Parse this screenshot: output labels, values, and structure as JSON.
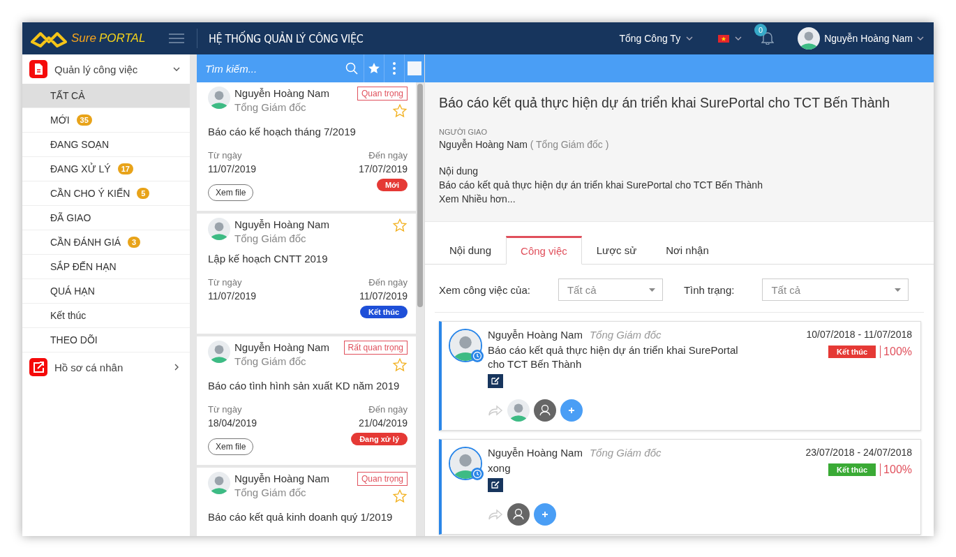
{
  "header": {
    "logo_left": "Sure",
    "logo_right": "PORTAL",
    "title": "HỆ THỐNG QUẢN LÝ CÔNG VIỆC",
    "company": "Tổng Công Ty",
    "notifications": "0",
    "user": "Nguyễn Hoàng Nam"
  },
  "sidebar": {
    "groups": [
      {
        "label": "Quản lý công việc",
        "kind": "document",
        "expanded": true,
        "items": [
          {
            "label": "TẤT CẢ",
            "selected": true
          },
          {
            "label": "MỚI",
            "badge": "35",
            "selected": false
          },
          {
            "label": "ĐANG SOẠN",
            "selected": false
          },
          {
            "label": "ĐANG XỬ LÝ",
            "badge": "17",
            "selected": false
          },
          {
            "label": "CẦN CHO Ý KIẾN",
            "badge": "5",
            "selected": false
          },
          {
            "label": "ĐÃ GIAO",
            "selected": false
          },
          {
            "label": "CẦN ĐÁNH GIÁ",
            "badge": "3",
            "selected": false
          },
          {
            "label": "SẮP ĐẾN HẠN",
            "selected": false
          },
          {
            "label": "QUÁ HẠN",
            "selected": false
          },
          {
            "label": "Kết thúc",
            "selected": false
          },
          {
            "label": "THEO DÕI",
            "selected": false
          }
        ]
      },
      {
        "label": "Hồ sơ cá nhân",
        "kind": "share",
        "expanded": false
      }
    ]
  },
  "task_list": {
    "search": {
      "placeholder": "Tìm kiếm..."
    },
    "cards": [
      {
        "name": "Nguyễn Hoàng Nam",
        "role": "Tổng Giám đốc",
        "priority": "Quan trọng",
        "starred": false,
        "title": "Báo cáo kế hoạch tháng 7/2019",
        "from_label": "Từ ngày",
        "from": "11/07/2019",
        "to_label": "Đến ngày",
        "to": "17/07/2019",
        "file_button": "Xem file",
        "status": {
          "label": "Mới",
          "color": "#e53935"
        }
      },
      {
        "name": "Nguyễn Hoàng Nam",
        "role": "Tổng Giám đốc",
        "starred": false,
        "title": "Lập kế hoạch CNTT 2019",
        "from_label": "Từ ngày",
        "from": "11/07/2019",
        "to_label": "Đến ngày",
        "to": "11/07/2019",
        "status": {
          "label": "Kết thúc",
          "color": "#1e4fd8"
        }
      },
      {
        "name": "Nguyễn Hoàng Nam",
        "role": "Tổng Giám đốc",
        "priority": "Rất quan trọng",
        "starred": false,
        "title": "Báo cáo tình hình sản xuất KD năm 2019",
        "from_label": "Từ ngày",
        "from": "18/04/2019",
        "to_label": "Đến ngày",
        "to": "21/04/2019",
        "file_button": "Xem file",
        "status": {
          "label": "Đang xử lý",
          "color": "#e53935"
        }
      },
      {
        "name": "Nguyễn Hoàng Nam",
        "role": "Tổng Giám đốc",
        "priority": "Quan trọng",
        "starred": false,
        "title": "Báo cáo kết quả kinh doanh quý 1/2019"
      }
    ]
  },
  "detail": {
    "title": "Báo cáo kết quả thực hiện dự án triển khai SurePortal cho TCT Bến Thành",
    "assigner_label": "NGƯỜI GIAO",
    "assigner": "Nguyễn Hoàng Nam",
    "assigner_role": "( Tổng Giám đốc )",
    "content_label": "Nội dung",
    "content": "Báo cáo kết quả thực hiện dự án triển khai SurePortal cho TCT Bến Thành",
    "more_link": "Xem Nhiều hơn...",
    "tabs": [
      {
        "label": "Nội dung",
        "selected": false
      },
      {
        "label": "Công việc",
        "selected": true
      },
      {
        "label": "Lược sử",
        "selected": false
      },
      {
        "label": "Nơi nhận",
        "selected": false
      }
    ],
    "filters": [
      {
        "label": "Xem công việc của:",
        "value": "Tất cả"
      },
      {
        "label": "Tình trạng:",
        "value": "Tất cả"
      }
    ],
    "tasks": [
      {
        "name": "Nguyễn Hoàng Nam",
        "role": "Tổng Giám đốc",
        "text": "Báo cáo kết quả thực hiện dự án triển khai SurePortal cho TCT Bến Thành",
        "dates": "10/07/2018 - 11/07/2018",
        "status": {
          "label": "Kết thúc",
          "color": "#e53935"
        },
        "percent": "100%",
        "assignees": [
          {
            "kind": "photo"
          },
          {
            "kind": "generic"
          }
        ]
      },
      {
        "name": "Nguyễn Hoàng Nam",
        "role": "Tổng Giám đốc",
        "text": "xong",
        "dates": "23/07/2018 - 24/07/2018",
        "status": {
          "label": "Kết thúc",
          "color": "#3aaa35"
        },
        "percent": "100%",
        "assignees": [
          {
            "kind": "generic"
          }
        ]
      }
    ]
  }
}
